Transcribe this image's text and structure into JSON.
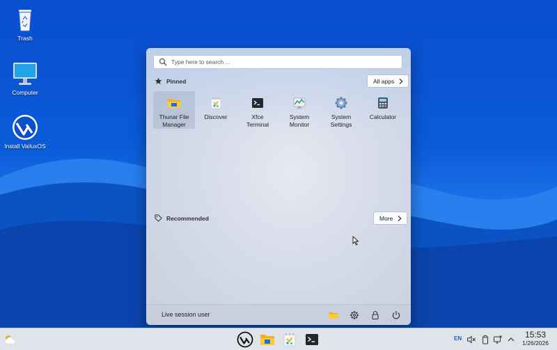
{
  "desktop": {
    "icons": [
      {
        "label": "Trash",
        "icon": "trash-icon"
      },
      {
        "label": "Computer",
        "icon": "computer-icon"
      },
      {
        "label": "Install VailuxOS",
        "icon": "vailux-logo-icon"
      }
    ]
  },
  "menu": {
    "search_placeholder": "Type here to search ...",
    "pinned_label": "Pinned",
    "all_apps_label": "All apps",
    "recommended_label": "Recommended",
    "more_label": "More",
    "pinned_apps": [
      {
        "line1": "Thunar File",
        "line2": "Manager",
        "icon": "folder-icon",
        "selected": true
      },
      {
        "line1": "Discover",
        "line2": "",
        "icon": "discover-icon"
      },
      {
        "line1": "Xfce",
        "line2": "Terminal",
        "icon": "terminal-icon"
      },
      {
        "line1": "System",
        "line2": "Monitor",
        "icon": "system-monitor-icon"
      },
      {
        "line1": "System",
        "line2": "Settings",
        "icon": "gear-icon"
      },
      {
        "line1": "Calculator",
        "line2": "",
        "icon": "calculator-icon"
      }
    ],
    "footer": {
      "user": "Live session user",
      "actions": [
        "folder-icon",
        "gear-icon",
        "lock-icon",
        "power-icon"
      ]
    }
  },
  "taskbar": {
    "pinned": [
      "vailux-logo-icon",
      "folder-icon",
      "discover-icon",
      "terminal-icon"
    ],
    "tray": {
      "language": "EN",
      "icons": [
        "volume-muted-icon",
        "clipboard-icon",
        "network-icon",
        "chevron-up-icon"
      ]
    },
    "clock": {
      "time": "15:53",
      "date": "1/26/2026"
    }
  },
  "colors": {
    "accent": "#1565c0",
    "wallpaper": "#0a4ed0",
    "taskbar": "#dfe3ea"
  }
}
